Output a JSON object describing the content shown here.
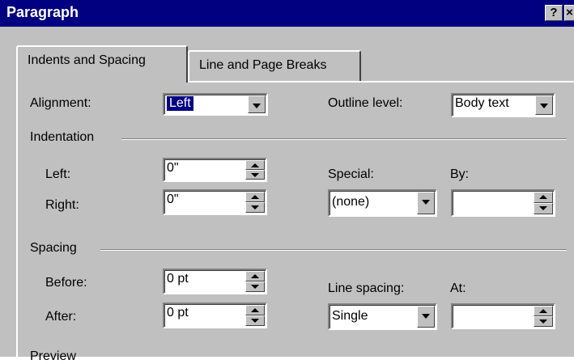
{
  "window": {
    "title": "Paragraph",
    "help_label": "?",
    "close_label": "×"
  },
  "tabs": [
    {
      "label": "Indents and Spacing",
      "active": true
    },
    {
      "label": "Line and Page Breaks",
      "active": false
    }
  ],
  "alignment": {
    "label": "Alignment:",
    "value": "Left"
  },
  "outline_level": {
    "label": "Outline level:",
    "value": "Body text"
  },
  "indentation": {
    "heading": "Indentation",
    "left": {
      "label": "Left:",
      "value": "0\""
    },
    "right": {
      "label": "Right:",
      "value": "0\""
    },
    "special": {
      "label": "Special:",
      "value": "(none)"
    },
    "by": {
      "label": "By:",
      "value": ""
    }
  },
  "spacing": {
    "heading": "Spacing",
    "before": {
      "label": "Before:",
      "value": "0 pt"
    },
    "after": {
      "label": "After:",
      "value": "0 pt"
    },
    "line_spacing": {
      "label": "Line spacing:",
      "value": "Single"
    },
    "at": {
      "label": "At:",
      "value": ""
    }
  },
  "preview": {
    "heading": "Preview"
  },
  "colors": {
    "titlebar": "#000080",
    "face": "#c0c0c0",
    "highlight": "#000080"
  }
}
